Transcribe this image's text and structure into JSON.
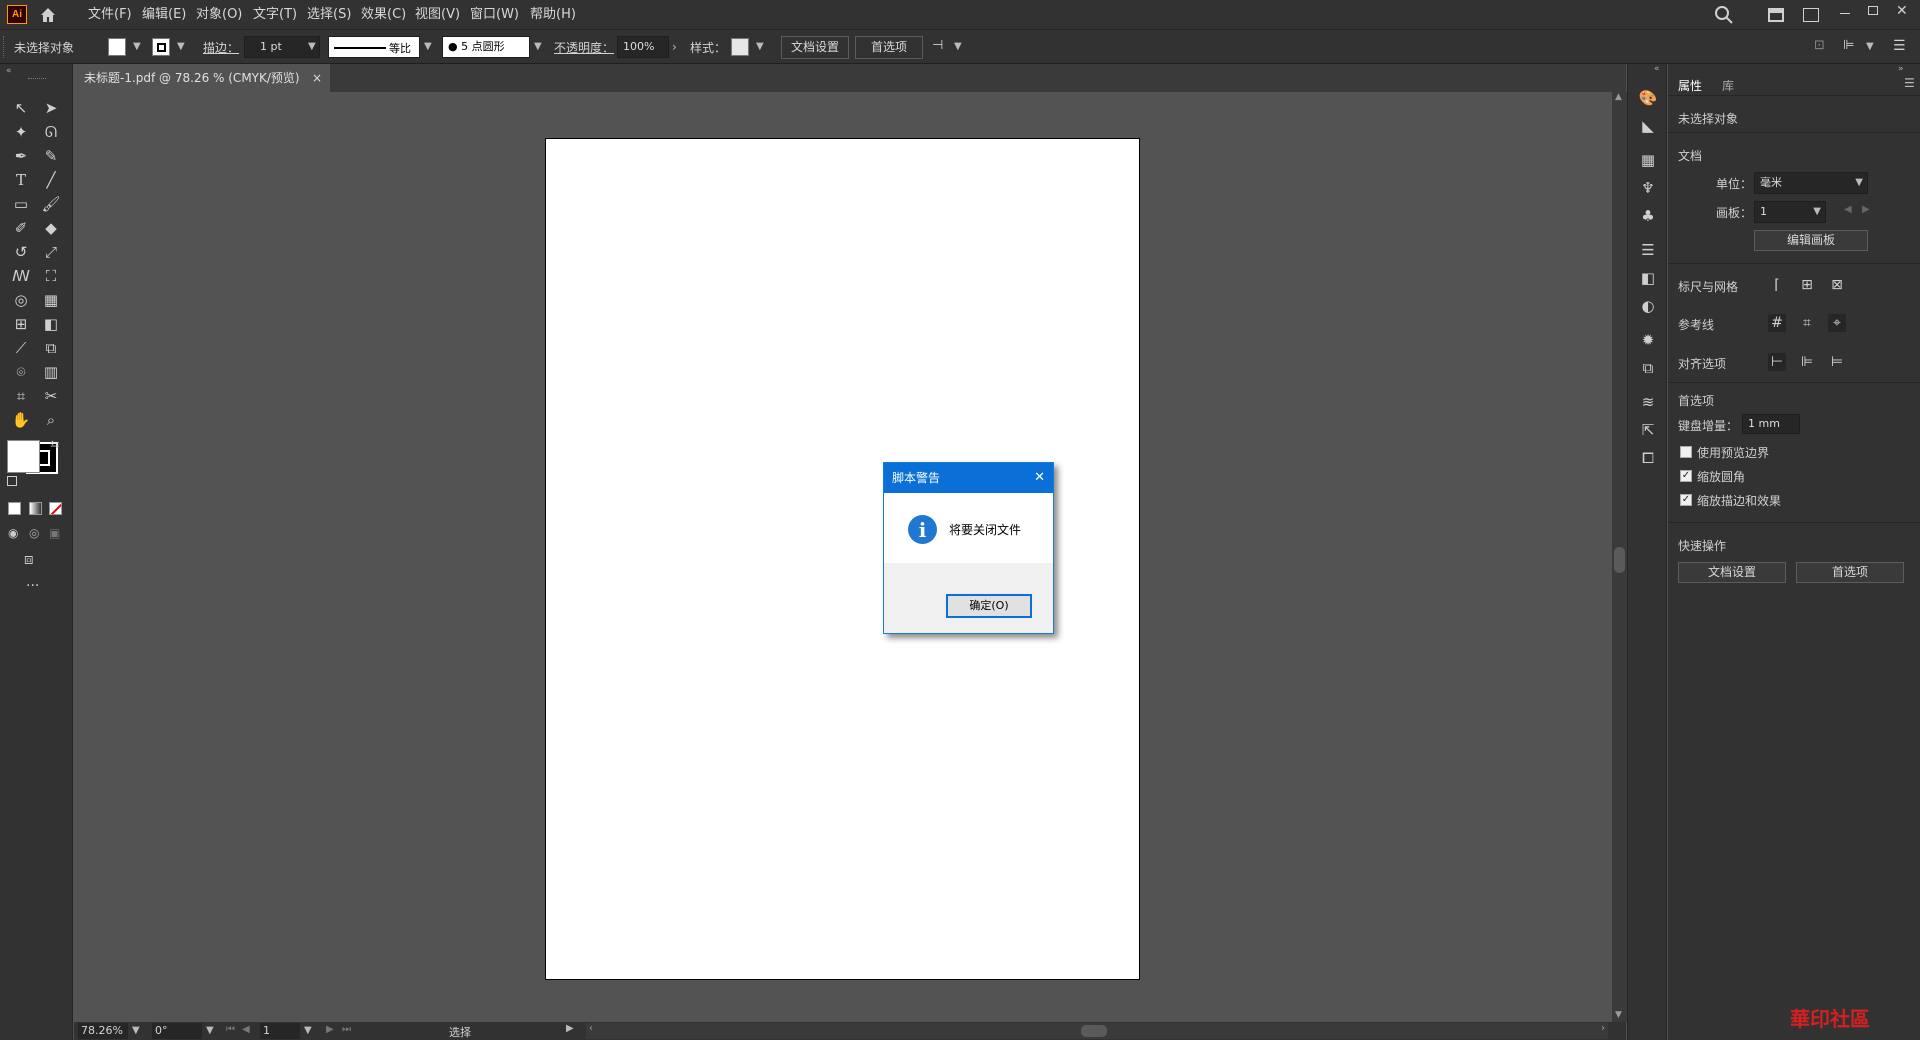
{
  "app": {
    "logo": "Ai"
  },
  "menu": [
    "文件(F)",
    "编辑(E)",
    "对象(O)",
    "文字(T)",
    "选择(S)",
    "效果(C)",
    "视图(V)",
    "窗口(W)",
    "帮助(H)"
  ],
  "control": {
    "selection": "未选择对象",
    "stroke_label": "描边：",
    "stroke_value": "1 pt",
    "profile": "等比",
    "brush": "● 5 点圆形",
    "opacity_label": "不透明度：",
    "opacity_value": "100%",
    "style_label": "样式：",
    "doc_setup": "文档设置",
    "prefs": "首选项"
  },
  "document": {
    "tab_title": "未标题-1.pdf @ 78.26 % (CMYK/预览)",
    "close": "×"
  },
  "status": {
    "zoom": "78.26%",
    "rotation": "0°",
    "artboard": "1",
    "tool": "选择"
  },
  "panel": {
    "tabs": [
      "属性",
      "库"
    ],
    "no_selection": "未选择对象",
    "document_header": "文档",
    "unit_label": "单位：",
    "unit_value": "毫米",
    "artboard_label": "画板：",
    "artboard_value": "1",
    "edit_artboards": "编辑画板",
    "rulers_grids": "标尺与网格",
    "guides": "参考线",
    "align_options": "对齐选项",
    "preferences_header": "首选项",
    "keyboard_increment_label": "键盘增量：",
    "keyboard_increment_value": "1 mm",
    "use_preview_bounds": "使用预览边界",
    "scale_corners": "缩放圆角",
    "scale_strokes": "缩放描边和效果",
    "quick_actions": "快速操作",
    "doc_setup": "文档设置",
    "prefs": "首选项"
  },
  "dialog": {
    "title": "脚本警告",
    "message": "将要关闭文件",
    "ok": "确定(O)",
    "close": "✕",
    "icon": "i"
  },
  "watermark": "華印社區",
  "colors": {
    "accent": "#0a6fd6",
    "ui_dark": "#323232",
    "canvas": "#535353"
  }
}
